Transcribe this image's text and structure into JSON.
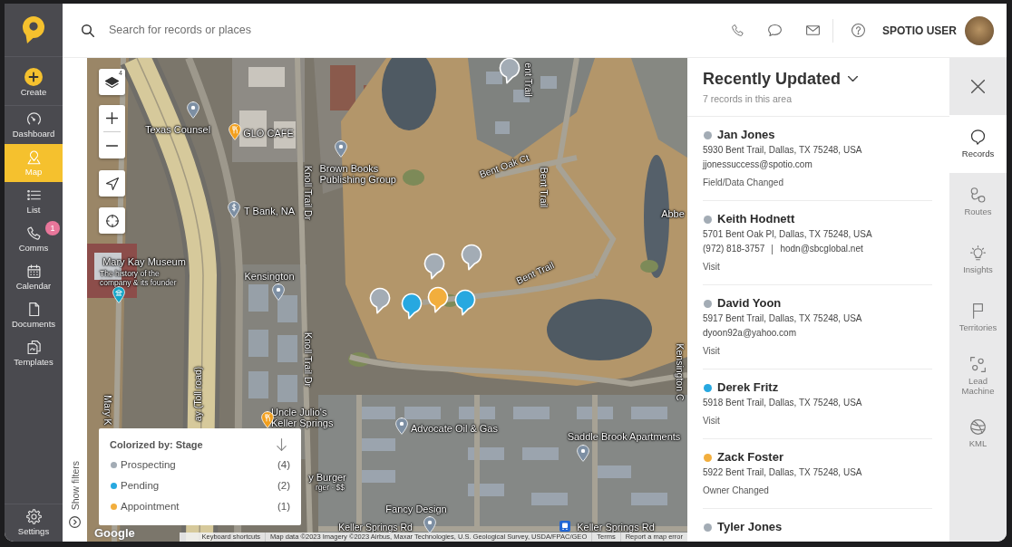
{
  "sidebar": {
    "create": {
      "label": "Create"
    },
    "items": [
      {
        "label": "Dashboard",
        "selected": false
      },
      {
        "label": "Map",
        "selected": true
      },
      {
        "label": "List",
        "selected": false
      },
      {
        "label": "Comms",
        "selected": false,
        "badge": "1"
      },
      {
        "label": "Calendar",
        "selected": false
      },
      {
        "label": "Documents",
        "selected": false
      },
      {
        "label": "Templates",
        "selected": false
      }
    ],
    "settings": {
      "label": "Settings"
    }
  },
  "topbar": {
    "search": {
      "placeholder": "Search for records or places"
    },
    "user": {
      "name": "SPOTIO USER"
    }
  },
  "filters": {
    "label": "Show filters"
  },
  "map": {
    "layers_count": "4",
    "markers": [
      {
        "color": "#a3acb5"
      },
      {
        "color": "#a3acb5"
      },
      {
        "color": "#a3acb5"
      },
      {
        "color": "#a3acb5"
      },
      {
        "color": "#27a8e0"
      },
      {
        "color": "#f2ae3d"
      },
      {
        "color": "#27a8e0"
      }
    ],
    "labels": [
      {
        "text": "ent Trail",
        "kind": "street"
      },
      {
        "text": "Texas Counsel",
        "kind": "poi"
      },
      {
        "text": "GLO CAFE",
        "kind": "restaurant"
      },
      {
        "text": "Brown Books Publishing Group",
        "kind": "poi"
      },
      {
        "text": "Knoll Trail Dr",
        "kind": "street"
      },
      {
        "text": "Bent Oak Ct",
        "kind": "street"
      },
      {
        "text": "Bent Trail",
        "kind": "street"
      },
      {
        "text": "T Bank, NA",
        "kind": "bank"
      },
      {
        "text": "Abbe",
        "kind": "place"
      },
      {
        "text": "Mary Kay Museum",
        "kind": "museum"
      },
      {
        "text": "The history of the company & its founder",
        "kind": "caption"
      },
      {
        "text": "Kensington",
        "kind": "poi"
      },
      {
        "text": "Bent Trail",
        "kind": "street"
      },
      {
        "text": "Knoll Trail Dr",
        "kind": "street"
      },
      {
        "text": "Kensington C",
        "kind": "street"
      },
      {
        "text": "Mary K",
        "kind": "street"
      },
      {
        "text": "ay (Toll road)",
        "kind": "street"
      },
      {
        "text": "Uncle Julio's Keller Springs",
        "kind": "restaurant"
      },
      {
        "text": "Advocate Oil & Gas",
        "kind": "poi"
      },
      {
        "text": "Saddle Brook Apartments",
        "kind": "poi"
      },
      {
        "text": "y Burger",
        "kind": "place"
      },
      {
        "text": "rger · $$",
        "kind": "caption"
      },
      {
        "text": "Fancy Design",
        "kind": "poi"
      },
      {
        "text": "Keller Springs Rd",
        "kind": "street"
      },
      {
        "text": "Keller Springs Rd",
        "kind": "transit"
      }
    ],
    "legend": {
      "title": "Colorized by: Stage",
      "items": [
        {
          "label": "Prospecting",
          "count": "(4)",
          "color": "#a3acb5"
        },
        {
          "label": "Pending",
          "count": "(2)",
          "color": "#27a8e0"
        },
        {
          "label": "Appointment",
          "count": "(1)",
          "color": "#f2ae3d"
        }
      ]
    },
    "attribution": {
      "logo": "Google",
      "items": [
        "Keyboard shortcuts",
        "Map data ©2023 Imagery ©2023 Airbus, Maxar Technologies, U.S. Geological Survey, USDA/FPAC/GEO",
        "Terms",
        "Report a map error"
      ]
    }
  },
  "panel": {
    "title": "Recently Updated",
    "subtitle": "7 records in this area",
    "records": [
      {
        "name": "Jan Jones",
        "color": "#a3acb5",
        "address": "5930 Bent Trail, Dallas, TX 75248, USA",
        "contacts": [
          "jjonessuccess@spotio.com"
        ],
        "activity": "Field/Data Changed"
      },
      {
        "name": "Keith Hodnett",
        "color": "#a3acb5",
        "address": "5701 Bent Oak Pl, Dallas, TX 75248, USA",
        "contacts": [
          "(972) 818-3757",
          "hodn@sbcglobal.net"
        ],
        "activity": "Visit"
      },
      {
        "name": "David Yoon",
        "color": "#a3acb5",
        "address": "5917 Bent Trail, Dallas, TX 75248, USA",
        "contacts": [
          "dyoon92a@yahoo.com"
        ],
        "activity": "Visit"
      },
      {
        "name": "Derek Fritz",
        "color": "#27a8e0",
        "address": "5918 Bent Trail, Dallas, TX 75248, USA",
        "activity": "Visit"
      },
      {
        "name": "Zack Foster",
        "color": "#f2ae3d",
        "address": "5922 Bent Trail, Dallas, TX 75248, USA",
        "activity": "Owner Changed"
      },
      {
        "name": "Tyler Jones",
        "color": "#a3acb5"
      }
    ]
  },
  "rail": {
    "tabs": [
      {
        "label": "Records",
        "selected": true
      },
      {
        "label": "Routes",
        "selected": false
      },
      {
        "label": "Insights",
        "selected": false
      },
      {
        "label": "Territories",
        "selected": false
      },
      {
        "label": "Lead Machine",
        "selected": false
      },
      {
        "label": "KML",
        "selected": false
      }
    ]
  }
}
